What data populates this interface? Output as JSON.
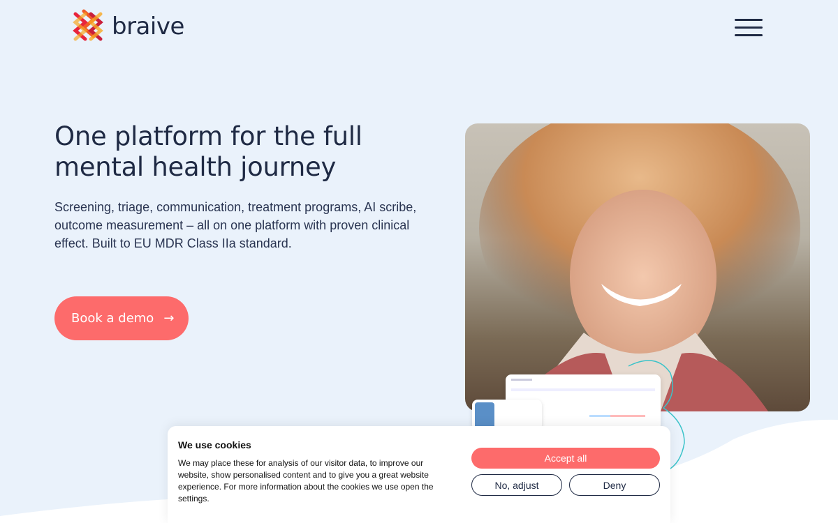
{
  "header": {
    "logo_text": "braive",
    "menu_icon": "hamburger-menu-icon"
  },
  "hero": {
    "title": "One platform for the full mental health journey",
    "subtitle": "Screening, triage, communication, treatment programs, AI scribe, outcome measurement – all on one platform with proven clinical effect. Built to EU MDR Class IIa standard.",
    "cta_label": "Book a demo",
    "cta_icon": "arrow-right-icon",
    "cta_arrow": "→"
  },
  "cookie_banner": {
    "title": "We use cookies",
    "text": "We may place these for analysis of our visitor data, to improve our website, show personalised content and to give you a great website experience. For more information about the cookies we use open the settings.",
    "accept_label": "Accept all",
    "adjust_label": "No, adjust",
    "deny_label": "Deny"
  },
  "colors": {
    "background": "#eaf2fb",
    "accent": "#fd6b6b",
    "text": "#1f2a44"
  }
}
